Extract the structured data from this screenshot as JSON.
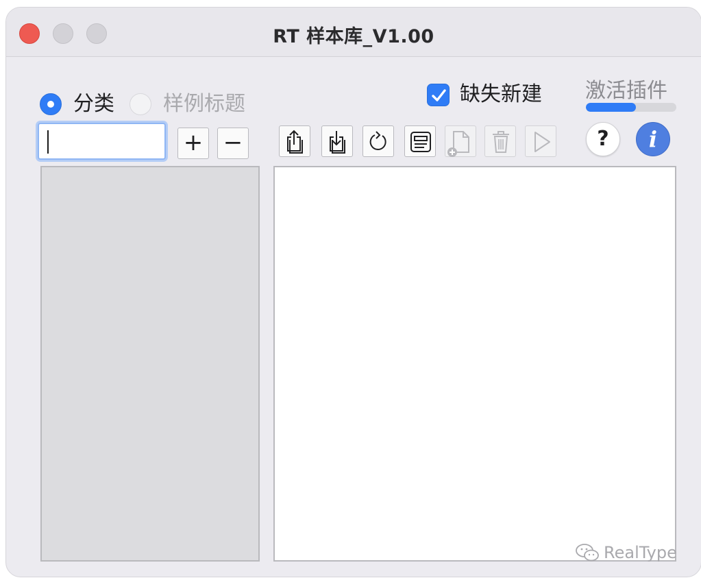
{
  "window": {
    "title": "RT 样本库_V1.00"
  },
  "radio_group": {
    "options": [
      {
        "label": "分类",
        "selected": true
      },
      {
        "label": "样例标题",
        "selected": false,
        "disabled": true
      }
    ]
  },
  "search": {
    "value": "",
    "placeholder": ""
  },
  "category_buttons": {
    "add_label": "+",
    "remove_label": "−"
  },
  "checkbox": {
    "label": "缺失新建",
    "checked": true
  },
  "activate": {
    "label": "激活插件",
    "progress": 0.55
  },
  "toolbar": {
    "buttons": [
      {
        "icon": "export-icon",
        "enabled": true
      },
      {
        "icon": "import-icon",
        "enabled": true
      },
      {
        "icon": "refresh-icon",
        "enabled": true
      },
      {
        "icon": "document-icon",
        "enabled": true
      },
      {
        "icon": "new-file-icon",
        "enabled": false
      },
      {
        "icon": "trash-icon",
        "enabled": false
      },
      {
        "icon": "play-icon",
        "enabled": false
      }
    ],
    "help_label": "?",
    "info_label": "i"
  },
  "watermark": {
    "text": "RealType"
  },
  "colors": {
    "accent": "#2f7cf6",
    "close": "#ee5a52",
    "window_bg": "#ecebf0",
    "panel_bg": "#dcdcdf"
  }
}
